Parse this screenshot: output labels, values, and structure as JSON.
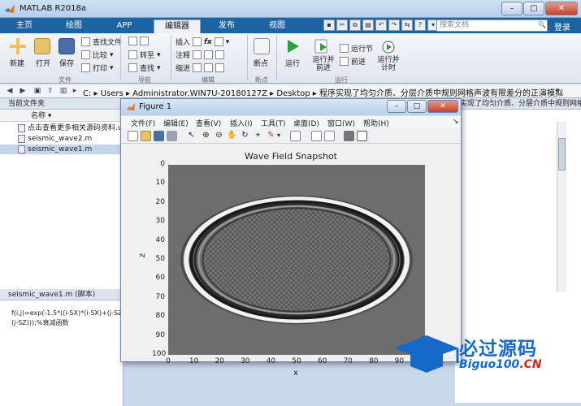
{
  "window": {
    "title": "MATLAB R2018a"
  },
  "tabs": [
    {
      "label": "主页"
    },
    {
      "label": "绘图"
    },
    {
      "label": "APP"
    },
    {
      "label": "编辑器"
    },
    {
      "label": "发布"
    },
    {
      "label": "视图"
    }
  ],
  "search": {
    "placeholder": "搜索文档"
  },
  "login_label": "登录",
  "ribbon": {
    "file": {
      "new": "新建",
      "open": "打开",
      "save": "保存",
      "find_files": "查找文件",
      "compare": "比较",
      "print": "打印",
      "group": "文件"
    },
    "nav": {
      "goto": "转至",
      "find": "查找",
      "group": "导航"
    },
    "edit": {
      "insert": "插入",
      "comment": "注释",
      "indent": "缩进",
      "fx": "fx",
      "group": "编辑"
    },
    "breakpoints": {
      "label": "断点",
      "group": "断点"
    },
    "run": {
      "run": "运行",
      "run_advance": "运行并前进",
      "run_section": "运行节",
      "advance": "前进",
      "run_time": "运行并计时",
      "group": "运行"
    }
  },
  "address": {
    "segments": [
      "C:",
      "Users",
      "Administrator.WIN7U-20180127Z",
      "Desktop",
      "程序实现了均匀介质、分层介质中规则网格声波有限差分的正演模拟"
    ]
  },
  "current_folder": {
    "header": "当前文件夹",
    "column": "名称",
    "files": [
      {
        "name": "点击查看更多相关源码资料.url",
        "selected": false
      },
      {
        "name": "seismic_wave2.m",
        "selected": false
      },
      {
        "name": "seismic_wave1.m",
        "selected": true
      }
    ]
  },
  "details": {
    "header": "seismic_wave1.m  (脚本)",
    "code_line1": "f(i,j)=exp(-1.5*((i-SX)*(i-SX)+(j-SZ",
    "code_line2": "(j-SZ)));%衰减函数"
  },
  "editor_behind": {
    "header": "实现了均匀介质、分层介质中规则网格声波有限差分..."
  },
  "figure": {
    "title": "Figure 1",
    "menu": [
      "文件(F)",
      "编辑(E)",
      "查看(V)",
      "插入(I)",
      "工具(T)",
      "桌面(D)",
      "窗口(W)",
      "帮助(H)"
    ]
  },
  "chart_data": {
    "type": "heatmap",
    "title": "Wave Field Snapshot",
    "xlabel": "x",
    "ylabel": "z",
    "xticks": [
      0,
      10,
      20,
      30,
      40,
      50,
      60,
      70,
      80,
      90
    ],
    "yticks": [
      0,
      10,
      20,
      30,
      40,
      50,
      60,
      70,
      80,
      90,
      100
    ],
    "xlim": [
      0,
      100
    ],
    "ylim": [
      0,
      100
    ],
    "colormap": "gray",
    "background_value_color": "#6d6d6d",
    "wavefront": {
      "center_x": 50,
      "center_z": 50,
      "radius_x": 43,
      "radius_z": 32
    }
  },
  "watermark": {
    "cn": "必过源码",
    "en_main": "Biguo100",
    "en_suffix": ".CN"
  }
}
